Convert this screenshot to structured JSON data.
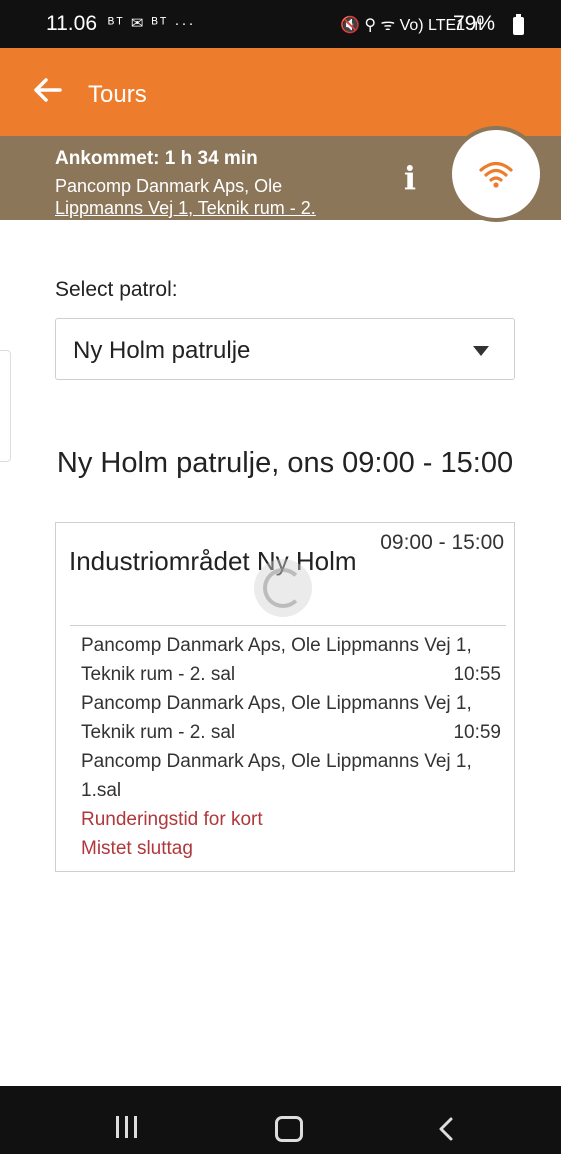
{
  "status_bar": {
    "time": "11.06",
    "left_icons": "ᴮᵀ ✉ ᴮᵀ ···",
    "right_icons": "🔇 ⚲ ᯤ Vo) LTE1 .ıl",
    "battery": "79%"
  },
  "header": {
    "title": "Tours",
    "back_icon": "arrow-left-icon"
  },
  "info_band": {
    "arrived": "Ankommet: 1 h 34 min",
    "address_line1": "Pancomp Danmark Aps, Ole",
    "address_line2": "Lippmanns Vej 1, Teknik rum - 2.",
    "info_icon": "i",
    "wifi_icon": "wifi-icon",
    "accent": "#ed7d2c",
    "band_color": "#8c7659"
  },
  "patrol_select": {
    "label": "Select patrol:",
    "value": "Ny Holm patrulje"
  },
  "patrol_heading": "Ny Holm patrulje, ons 09:00 - 15:00",
  "card": {
    "title": "Industriområdet Ny Holm",
    "time": "09:00 - 15:00",
    "entries": [
      {
        "text": "Pancomp Danmark Aps, Ole Lippmanns Vej 1, Teknik rum - 2. sal",
        "time": "10:55"
      },
      {
        "text": "Pancomp Danmark Aps, Ole Lippmanns Vej 1, Teknik rum - 2. sal",
        "time": "10:59"
      },
      {
        "text": "Pancomp Danmark Aps, Ole Lippmanns Vej 1, 1.sal",
        "time": ""
      }
    ],
    "warnings": [
      "Runderingstid for kort",
      "Mistet sluttag"
    ],
    "warning_color": "#b0373a"
  },
  "nav_bar": {
    "recent": "recent-apps-icon",
    "home": "home-icon",
    "back": "back-icon"
  }
}
